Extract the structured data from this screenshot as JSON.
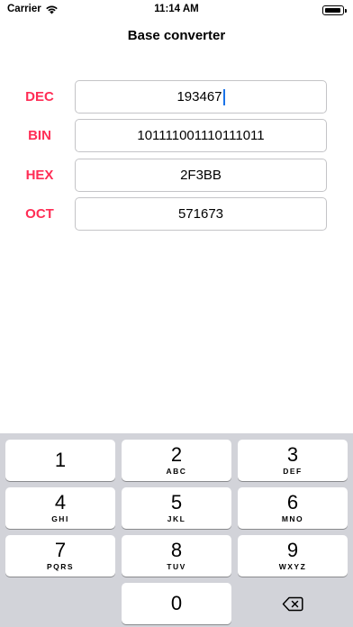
{
  "status": {
    "carrier": "Carrier",
    "time": "11:14 AM",
    "icons": [
      "wifi-icon",
      "battery-icon"
    ]
  },
  "nav": {
    "title": "Base converter"
  },
  "rows": [
    {
      "label": "DEC",
      "value": "193467"
    },
    {
      "label": "BIN",
      "value": "101111001110111011"
    },
    {
      "label": "HEX",
      "value": "2F3BB"
    },
    {
      "label": "OCT",
      "value": "571673"
    }
  ],
  "keypad": {
    "keys": [
      {
        "digit": "1",
        "letters": ""
      },
      {
        "digit": "2",
        "letters": "ABC"
      },
      {
        "digit": "3",
        "letters": "DEF"
      },
      {
        "digit": "4",
        "letters": "GHI"
      },
      {
        "digit": "5",
        "letters": "JKL"
      },
      {
        "digit": "6",
        "letters": "MNO"
      },
      {
        "digit": "7",
        "letters": "PQRS"
      },
      {
        "digit": "8",
        "letters": "TUV"
      },
      {
        "digit": "9",
        "letters": "WXYZ"
      },
      {
        "digit": "0",
        "letters": ""
      }
    ],
    "delete_icon": "delete-backspace-icon"
  },
  "colors": {
    "label": "#ff2d55",
    "cursor": "#1a73e8",
    "keypad_bg": "#d2d3d9"
  }
}
